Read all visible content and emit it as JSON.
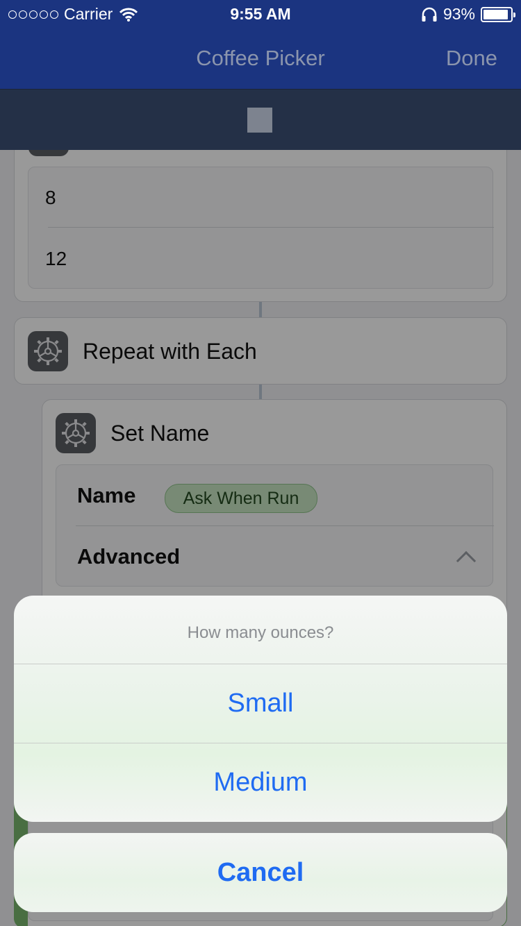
{
  "status_bar": {
    "carrier": "Carrier",
    "time": "9:55 AM",
    "battery": "93%",
    "battery_level": 0.93
  },
  "nav": {
    "title": "Coffee Picker",
    "done_label": "Done"
  },
  "list_items": [
    "8",
    "12"
  ],
  "repeat_action": {
    "title": "Repeat with Each",
    "icon": "gear-icon"
  },
  "set_name_action": {
    "title": "Set Name",
    "icon": "gear-icon",
    "name_label": "Name",
    "name_value": "Ask When Run",
    "advanced_label": "Advanced"
  },
  "action_sheet": {
    "title": "How many ounces?",
    "options": [
      "Small",
      "Medium"
    ],
    "cancel_label": "Cancel"
  },
  "colors": {
    "nav_bar": "#1b3480",
    "toolbar": "#243047",
    "accent": "#1f6bf2",
    "variable_pill": "#c8e6c4"
  }
}
